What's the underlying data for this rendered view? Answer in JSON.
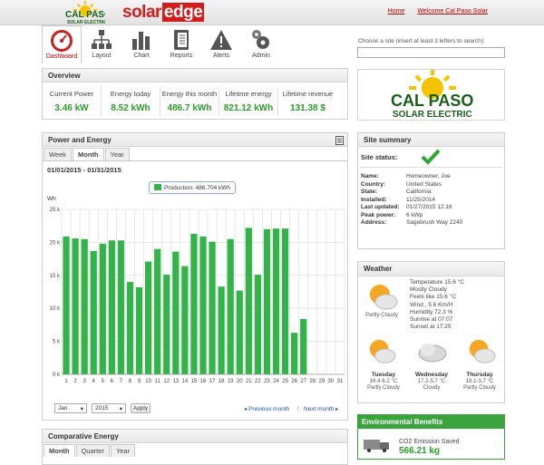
{
  "header": {
    "logo_text": "CAL PASO",
    "logo_sub": "SOLAR ELECTRIC",
    "brand_a": "solar",
    "brand_b": "edge",
    "home_link": "Home",
    "welcome_link": "Welcome Cal Paso Solar"
  },
  "nav": [
    {
      "label": "Dashboard",
      "icon": "gauge-icon"
    },
    {
      "label": "Layout",
      "icon": "layout-tree-icon"
    },
    {
      "label": "Chart",
      "icon": "bar-chart-icon"
    },
    {
      "label": "Reports",
      "icon": "notebook-icon"
    },
    {
      "label": "Alerts",
      "icon": "warning-icon"
    },
    {
      "label": "Admin",
      "icon": "gears-icon"
    }
  ],
  "site_search": {
    "label": "Choose a site (insert at least 3 letters to search):",
    "value": ""
  },
  "overview": {
    "title": "Overview",
    "cells": [
      {
        "title": "Current Power",
        "value": "3.46 kW"
      },
      {
        "title": "Energy today",
        "value": "8.52 kWh"
      },
      {
        "title": "Energy this month",
        "value": "486.7 kWh"
      },
      {
        "title": "Lifetime energy",
        "value": "821.12 kWh"
      },
      {
        "title": "Lifetime revenue",
        "value": "131.38 $"
      }
    ]
  },
  "power_energy": {
    "title": "Power and Energy",
    "tabs": [
      "Week",
      "Month",
      "Year"
    ],
    "active_tab": "Month",
    "date_range": "01/01/2015 - 01/31/2015",
    "month_select": "Jan",
    "year_select": "2015",
    "apply_label": "Apply",
    "prev_label": "Previous month",
    "next_label": "Next month",
    "separator": "|"
  },
  "chart_data": {
    "type": "bar",
    "ylabel": "Wh",
    "ylim": [
      0,
      25000
    ],
    "yticks": [
      "0 k",
      "5 k",
      "10 k",
      "15 k",
      "20 k",
      "25 k"
    ],
    "categories": [
      "1",
      "2",
      "3",
      "4",
      "5",
      "6",
      "7",
      "8",
      "9",
      "10",
      "11",
      "12",
      "13",
      "14",
      "15",
      "16",
      "17",
      "18",
      "19",
      "20",
      "21",
      "22",
      "23",
      "24",
      "25",
      "26",
      "27",
      "28",
      "29",
      "30",
      "31"
    ],
    "series": [
      {
        "name": "Production: 486.704 kWh",
        "color": "#34b34a",
        "values": [
          20900,
          20600,
          20500,
          18700,
          19800,
          20300,
          20300,
          14000,
          13200,
          17100,
          19000,
          15100,
          18600,
          16400,
          21300,
          20900,
          20100,
          13300,
          20500,
          12700,
          22200,
          15100,
          22000,
          22100,
          22100,
          6300,
          8400,
          0,
          0,
          0,
          0
        ]
      }
    ],
    "grid": true,
    "legend": "top"
  },
  "comparative": {
    "title": "Comparative Energy",
    "tabs": [
      "Month",
      "Quarter",
      "Year"
    ],
    "active_tab": "Month"
  },
  "site_summary": {
    "title": "Site summary",
    "status_label": "Site status:",
    "rows": [
      {
        "k": "Name:",
        "v": "Homeowner, Joe"
      },
      {
        "k": "Country:",
        "v": "United States"
      },
      {
        "k": "State:",
        "v": "California"
      },
      {
        "k": "Installed:",
        "v": "11/25/2014"
      },
      {
        "k": "Last updated:",
        "v": "01/27/2015 12:16"
      },
      {
        "k": "Peak power:",
        "v": "6 kWp"
      },
      {
        "k": "Address:",
        "v": "Sagebrush Way 2240"
      }
    ]
  },
  "weather": {
    "title": "Weather",
    "lines": [
      "Temperature 15.6 °C",
      "Mostly Cloudy",
      "Feels like 15.6 °C",
      "Wind , 5.6 Km/H",
      "Humidity 72.3 %",
      "Sunrise at 07:07",
      "Sunset at 17:25"
    ],
    "today_label": "Partly Cloudy",
    "days": [
      {
        "day": "Tuesday",
        "temp": "16.4-6.2 °C",
        "cond": "Partly Cloudy"
      },
      {
        "day": "Wednesday",
        "temp": "17.2-5.7 °C",
        "cond": "Cloudy"
      },
      {
        "day": "Thursday",
        "temp": "18.1-3.7 °C",
        "cond": "Partly Cloudy"
      }
    ]
  },
  "environment": {
    "title": "Environmental Benefits",
    "co2_label": "CO2 Emission Saved",
    "co2_value": "566.21 kg"
  },
  "colors": {
    "accent_red": "#c00000",
    "green": "#34b34a",
    "env_green": "#3aa33e",
    "brand_red": "#d31d1d"
  }
}
